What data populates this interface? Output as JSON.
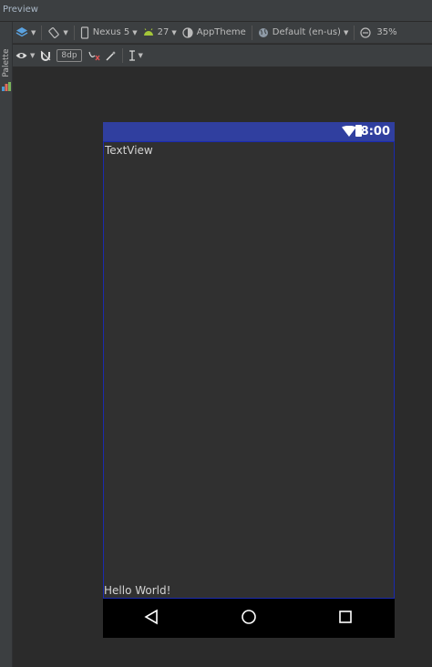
{
  "window": {
    "title": "Preview"
  },
  "side_panel": {
    "label": "Palette"
  },
  "toolbar": {
    "device": "Nexus 5",
    "api_level": "27",
    "theme": "AppTheme",
    "locale": "Default (en-us)",
    "zoom": "35%",
    "margin": "8dp"
  },
  "phone": {
    "status_time": "8:00",
    "text_top": "TextView",
    "text_bottom": "Hello World!"
  },
  "colors": {
    "status_bar": "#303f9f",
    "layout_border": "#1a2ab0",
    "android_green": "#a4c639"
  }
}
